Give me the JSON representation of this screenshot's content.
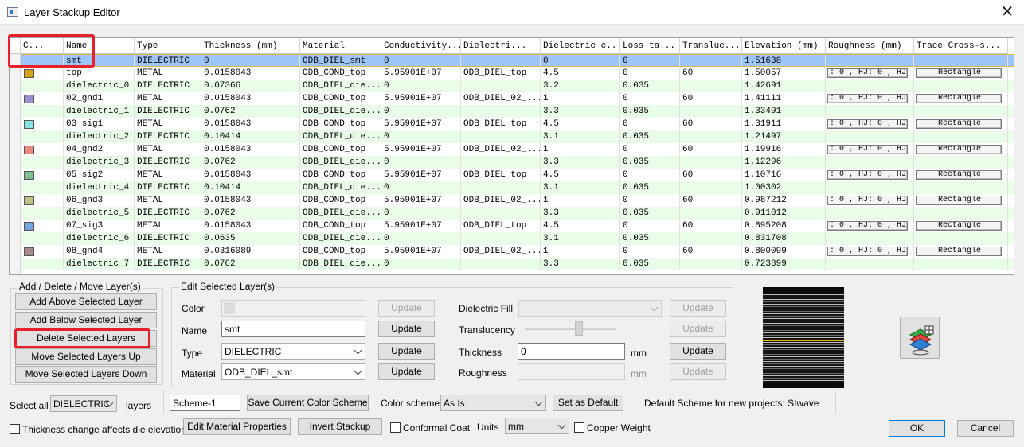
{
  "window": {
    "title": "Layer Stackup Editor",
    "close_symbol": "✕"
  },
  "grid": {
    "columns": [
      {
        "label": "C..."
      },
      {
        "label": "Name"
      },
      {
        "label": "Type"
      },
      {
        "label": "Thickness (mm)"
      },
      {
        "label": "Material"
      },
      {
        "label": "Conductivity..."
      },
      {
        "label": "Dielectri..."
      },
      {
        "label": "Dielectric c..."
      },
      {
        "label": "Loss ta..."
      },
      {
        "label": "Transluc..."
      },
      {
        "label": "Elevation (mm)"
      },
      {
        "label": "Roughness (mm)"
      },
      {
        "label": "Trace Cross-s..."
      }
    ],
    "rows": [
      {
        "color": "",
        "name": "smt",
        "type": "DIELECTRIC",
        "thickness": "0",
        "material": "ODB_DIEL_smt",
        "conductivity": "0",
        "dielectric_fill": "",
        "dk": "0",
        "loss": "0",
        "transluc": "",
        "elevation": "1.51638",
        "roughness": "",
        "trace": "",
        "selected": true,
        "bg": "#9ec5f7"
      },
      {
        "color": "#d4a017",
        "name": "top",
        "type": "METAL",
        "thickness": "0.0158043",
        "material": "ODB_COND_top",
        "conductivity": "5.95901E+07",
        "dielectric_fill": "ODB_DIEL_top",
        "dk": "4.5",
        "loss": "0",
        "transluc": "60",
        "elevation": "1.50057",
        "roughness": ": 0 , HJ: 0 , HJ:",
        "trace": "Rectangle",
        "bg": "#ffffff"
      },
      {
        "color": "",
        "name": "dielectric_0",
        "type": "DIELECTRIC",
        "thickness": "0.07366",
        "material": "ODB_DIEL_die...",
        "conductivity": "0",
        "dielectric_fill": "",
        "dk": "3.2",
        "loss": "0.035",
        "transluc": "",
        "elevation": "1.42691",
        "roughness": "",
        "trace": "",
        "bg": "#eafde8"
      },
      {
        "color": "#9e8fd1",
        "name": "02_gnd1",
        "type": "METAL",
        "thickness": "0.0158043",
        "material": "ODB_COND_top",
        "conductivity": "5.95901E+07",
        "dielectric_fill": "ODB_DIEL_02_...",
        "dk": "1",
        "loss": "0",
        "transluc": "60",
        "elevation": "1.41111",
        "roughness": ": 0 , HJ: 0 , HJ:",
        "trace": "Rectangle",
        "bg": "#ffffff"
      },
      {
        "color": "",
        "name": "dielectric_1",
        "type": "DIELECTRIC",
        "thickness": "0.0762",
        "material": "ODB_DIEL_die...",
        "conductivity": "0",
        "dielectric_fill": "",
        "dk": "3.3",
        "loss": "0.035",
        "transluc": "",
        "elevation": "1.33491",
        "roughness": "",
        "trace": "",
        "bg": "#eafde8"
      },
      {
        "color": "#86e3e0",
        "name": "03_sig1",
        "type": "METAL",
        "thickness": "0.0158043",
        "material": "ODB_COND_top",
        "conductivity": "5.95901E+07",
        "dielectric_fill": "ODB_DIEL_top",
        "dk": "4.5",
        "loss": "0",
        "transluc": "60",
        "elevation": "1.31911",
        "roughness": ": 0 , HJ: 0 , HJ:",
        "trace": "Rectangle",
        "bg": "#ffffff"
      },
      {
        "color": "",
        "name": "dielectric_2",
        "type": "DIELECTRIC",
        "thickness": "0.10414",
        "material": "ODB_DIEL_die...",
        "conductivity": "0",
        "dielectric_fill": "",
        "dk": "3.1",
        "loss": "0.035",
        "transluc": "",
        "elevation": "1.21497",
        "roughness": "",
        "trace": "",
        "bg": "#eafde8"
      },
      {
        "color": "#ec8a7f",
        "name": "04_gnd2",
        "type": "METAL",
        "thickness": "0.0158043",
        "material": "ODB_COND_top",
        "conductivity": "5.95901E+07",
        "dielectric_fill": "ODB_DIEL_02_...",
        "dk": "1",
        "loss": "0",
        "transluc": "60",
        "elevation": "1.19916",
        "roughness": ": 0 , HJ: 0 , HJ:",
        "trace": "Rectangle",
        "bg": "#ffffff"
      },
      {
        "color": "",
        "name": "dielectric_3",
        "type": "DIELECTRIC",
        "thickness": "0.0762",
        "material": "ODB_DIEL_die...",
        "conductivity": "0",
        "dielectric_fill": "",
        "dk": "3.3",
        "loss": "0.035",
        "transluc": "",
        "elevation": "1.12296",
        "roughness": "",
        "trace": "",
        "bg": "#eafde8"
      },
      {
        "color": "#7bbf8c",
        "name": "05_sig2",
        "type": "METAL",
        "thickness": "0.0158043",
        "material": "ODB_COND_top",
        "conductivity": "5.95901E+07",
        "dielectric_fill": "ODB_DIEL_top",
        "dk": "4.5",
        "loss": "0",
        "transluc": "60",
        "elevation": "1.10716",
        "roughness": ": 0 , HJ: 0 , HJ:",
        "trace": "Rectangle",
        "bg": "#ffffff"
      },
      {
        "color": "",
        "name": "dielectric_4",
        "type": "DIELECTRIC",
        "thickness": "0.10414",
        "material": "ODB_DIEL_die...",
        "conductivity": "0",
        "dielectric_fill": "",
        "dk": "3.1",
        "loss": "0.035",
        "transluc": "",
        "elevation": "1.00302",
        "roughness": "",
        "trace": "",
        "bg": "#eafde8"
      },
      {
        "color": "#bfc488",
        "name": "06_gnd3",
        "type": "METAL",
        "thickness": "0.0158043",
        "material": "ODB_COND_top",
        "conductivity": "5.95901E+07",
        "dielectric_fill": "ODB_DIEL_02_...",
        "dk": "1",
        "loss": "0",
        "transluc": "60",
        "elevation": "0.987212",
        "roughness": ": 0 , HJ: 0 , HJ:",
        "trace": "Rectangle",
        "bg": "#ffffff"
      },
      {
        "color": "",
        "name": "dielectric_5",
        "type": "DIELECTRIC",
        "thickness": "0.0762",
        "material": "ODB_DIEL_die...",
        "conductivity": "0",
        "dielectric_fill": "",
        "dk": "3.3",
        "loss": "0.035",
        "transluc": "",
        "elevation": "0.911012",
        "roughness": "",
        "trace": "",
        "bg": "#eafde8"
      },
      {
        "color": "#79a4e2",
        "name": "07_sig3",
        "type": "METAL",
        "thickness": "0.0158043",
        "material": "ODB_COND_top",
        "conductivity": "5.95901E+07",
        "dielectric_fill": "ODB_DIEL_top",
        "dk": "4.5",
        "loss": "0",
        "transluc": "60",
        "elevation": "0.895208",
        "roughness": ": 0 , HJ: 0 , HJ:",
        "trace": "Rectangle",
        "bg": "#ffffff"
      },
      {
        "color": "",
        "name": "dielectric_6",
        "type": "DIELECTRIC",
        "thickness": "0.0635",
        "material": "ODB_DIEL_die...",
        "conductivity": "0",
        "dielectric_fill": "",
        "dk": "3.1",
        "loss": "0.035",
        "transluc": "",
        "elevation": "0.831708",
        "roughness": "",
        "trace": "",
        "bg": "#eafde8"
      },
      {
        "color": "#a58d8d",
        "name": "08_gnd4",
        "type": "METAL",
        "thickness": "0.0316089",
        "material": "ODB_COND_top",
        "conductivity": "5.95901E+07",
        "dielectric_fill": "ODB_DIEL_02_...",
        "dk": "1",
        "loss": "0",
        "transluc": "60",
        "elevation": "0.800099",
        "roughness": ": 0 , HJ: 0 , HJ:",
        "trace": "Rectangle",
        "bg": "#ffffff"
      },
      {
        "color": "",
        "name": "dielectric_7",
        "type": "DIELECTRIC",
        "thickness": "0.0762",
        "material": "ODB_DIEL_die...",
        "conductivity": "0",
        "dielectric_fill": "",
        "dk": "3.3",
        "loss": "0.035",
        "transluc": "",
        "elevation": "0.723899",
        "roughness": "",
        "trace": "",
        "bg": "#eafde8"
      }
    ]
  },
  "layer_ops": {
    "title": "Add / Delete / Move Layer(s)",
    "add_above": "Add Above Selected Layer",
    "add_below": "Add Below Selected Layer",
    "delete": "Delete Selected Layers",
    "move_up": "Move Selected Layers Up",
    "move_down": "Move Selected Layers Down"
  },
  "edit": {
    "title": "Edit Selected Layer(s)",
    "color_label": "Color",
    "name_label": "Name",
    "name_value": "smt",
    "type_label": "Type",
    "type_value": "DIELECTRIC",
    "material_label": "Material",
    "material_value": "ODB_DIEL_smt",
    "update": "Update",
    "dielectric_fill_label": "Dielectric Fill",
    "translucency_label": "Translucency",
    "thickness_label": "Thickness",
    "thickness_value": "0",
    "thickness_unit": "mm",
    "roughness_label": "Roughness",
    "roughness_unit": "mm"
  },
  "bottom": {
    "select_all": "Select all",
    "select_type": "DIELECTRIC",
    "layers": "layers",
    "scheme_name": "Scheme-1",
    "save_scheme": "Save Current Color Scheme",
    "color_scheme_label": "Color scheme",
    "color_scheme_value": "As Is",
    "set_default": "Set as Default",
    "default_scheme_text": "Default Scheme for new projects: SIwave",
    "thickness_change": "Thickness change affects die elevations",
    "edit_material": "Edit Material Properties",
    "invert": "Invert Stackup",
    "conformal": "Conformal Coat",
    "units_label": "Units",
    "units_value": "mm",
    "copper_weight": "Copper Weight",
    "ok": "OK",
    "cancel": "Cancel"
  },
  "colors": {
    "selection": "#9ec5f7",
    "dielectric_row": "#eafde8",
    "highlight_red": "#e8202a"
  }
}
